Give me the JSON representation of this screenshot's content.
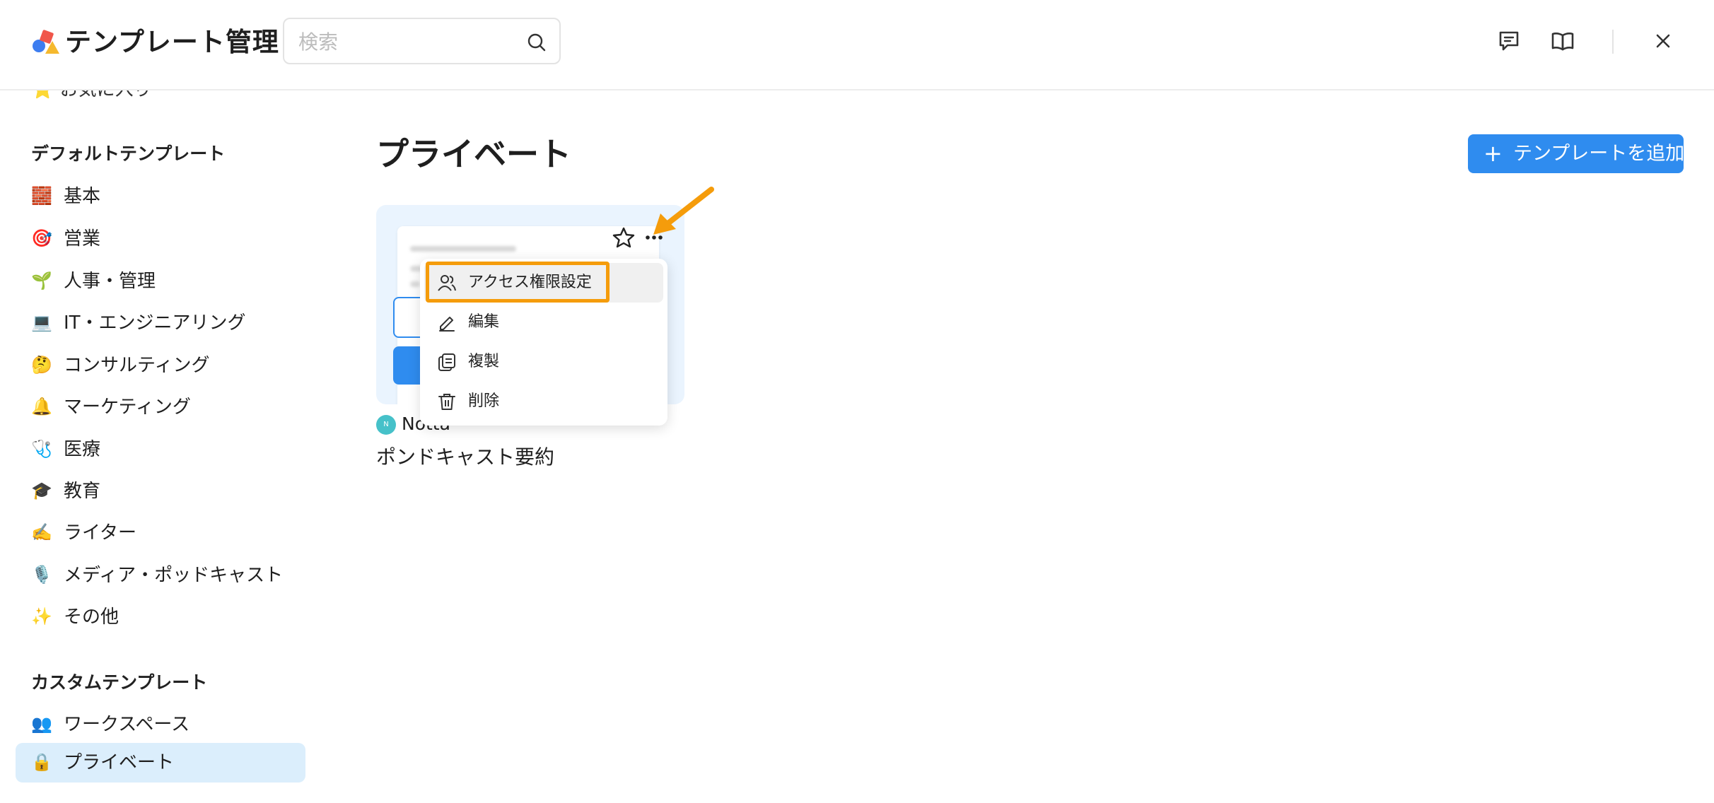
{
  "header": {
    "title": "テンプレート管理",
    "search_placeholder": "検索",
    "actions": [
      "feedback-icon",
      "book-icon",
      "close-icon"
    ]
  },
  "sidebar": {
    "cut_off_item": "お気に入り",
    "default_section_title": "デフォルトテンプレート",
    "default_items": [
      {
        "icon": "🧱",
        "label": "基本"
      },
      {
        "icon": "🎯",
        "label": "営業"
      },
      {
        "icon": "🌱",
        "label": "人事・管理"
      },
      {
        "icon": "💻",
        "label": "IT・エンジニアリング"
      },
      {
        "icon": "🤔",
        "label": "コンサルティング"
      },
      {
        "icon": "🔔",
        "label": "マーケティング"
      },
      {
        "icon": "🩺",
        "label": "医療"
      },
      {
        "icon": "🎓",
        "label": "教育"
      },
      {
        "icon": "✍️",
        "label": "ライター"
      },
      {
        "icon": "🎙️",
        "label": "メディア・ポッドキャスト"
      },
      {
        "icon": "✨",
        "label": "その他"
      }
    ],
    "custom_section_title": "カスタムテンプレート",
    "custom_items": [
      {
        "icon": "👥",
        "label": "ワークスペース"
      },
      {
        "icon": "🔒",
        "label": "プライベート",
        "active": true
      }
    ]
  },
  "main": {
    "title": "プライベート",
    "add_button_label": "テンプレートを追加",
    "card": {
      "author_initial": "N",
      "author_name": "Notta",
      "title": "ポンドキャスト要約"
    },
    "context_menu": [
      {
        "icon": "users-icon",
        "label": "アクセス権限設定",
        "highlighted": true
      },
      {
        "icon": "pen-icon",
        "label": "編集"
      },
      {
        "icon": "copy-icon",
        "label": "複製"
      },
      {
        "icon": "trash-icon",
        "label": "削除"
      }
    ]
  },
  "colors": {
    "accent": "#2f8cef",
    "active_nav_bg": "#dbeefc",
    "card_bg": "#eaf4fe",
    "annotation": "#f59c0b"
  }
}
